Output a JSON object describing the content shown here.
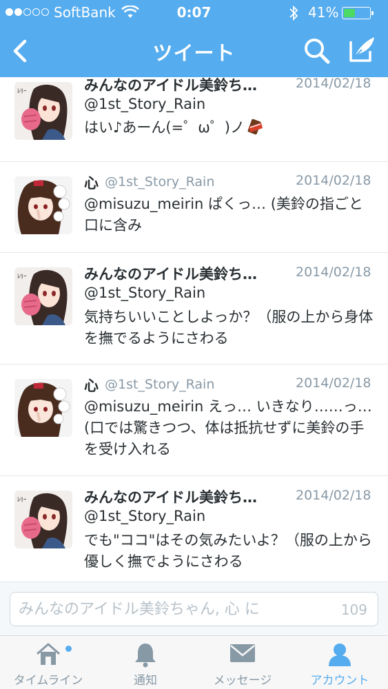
{
  "status_bar": {
    "carrier": "SoftBank",
    "time": "0:07",
    "battery_percent": "41%",
    "signal_bars_filled": 2,
    "signal_bars_total": 5,
    "battery_level": 0.41
  },
  "nav": {
    "title": "ツイート",
    "back_icon": "chevron-left-icon",
    "search_icon": "search-icon",
    "compose_icon": "compose-icon"
  },
  "tweets": [
    {
      "name": "みんなのアイドル美鈴ち…",
      "handle": "@1st_Story_Rain",
      "date": "2014/02/18",
      "text": "はい♪あーん(=゜ω゜)ノ",
      "emoji": "chocolate-bar-icon"
    },
    {
      "name": "心",
      "handle": "@1st_Story_Rain",
      "date": "2014/02/18",
      "text": "@misuzu_meirin ぱくっ… (美鈴の指ごと口に含み"
    },
    {
      "name": "みんなのアイドル美鈴ち…",
      "handle": "@1st_Story_Rain",
      "date": "2014/02/18",
      "text": "気持ちいいことしよっか？（服の上から身体を撫でるようにさわる"
    },
    {
      "name": "心",
      "handle": "@1st_Story_Rain",
      "date": "2014/02/18",
      "text": "@misuzu_meirin えっ… いきなり……っ…(口では驚きつつ、体は抵抗せずに美鈴の手を受け入れる"
    },
    {
      "name": "みんなのアイドル美鈴ち…",
      "handle": "@1st_Story_Rain",
      "date": "2014/02/18",
      "text": "でも\"ココ\"はその気みたいよ？（服の上から優しく撫でようにさわる"
    }
  ],
  "reply": {
    "placeholder": "みんなのアイドル美鈴ちゃん, 心 に",
    "char_count": "109"
  },
  "tabs": [
    {
      "label": "タイムライン",
      "icon": "home-icon",
      "active": false,
      "has_badge": true
    },
    {
      "label": "通知",
      "icon": "bell-icon",
      "active": false
    },
    {
      "label": "メッセージ",
      "icon": "envelope-icon",
      "active": false
    },
    {
      "label": "アカウント",
      "icon": "person-icon",
      "active": true
    }
  ],
  "colors": {
    "brand": "#55acee",
    "text": "#292f33",
    "muted": "#8899a6",
    "battery": "#4cd964"
  }
}
